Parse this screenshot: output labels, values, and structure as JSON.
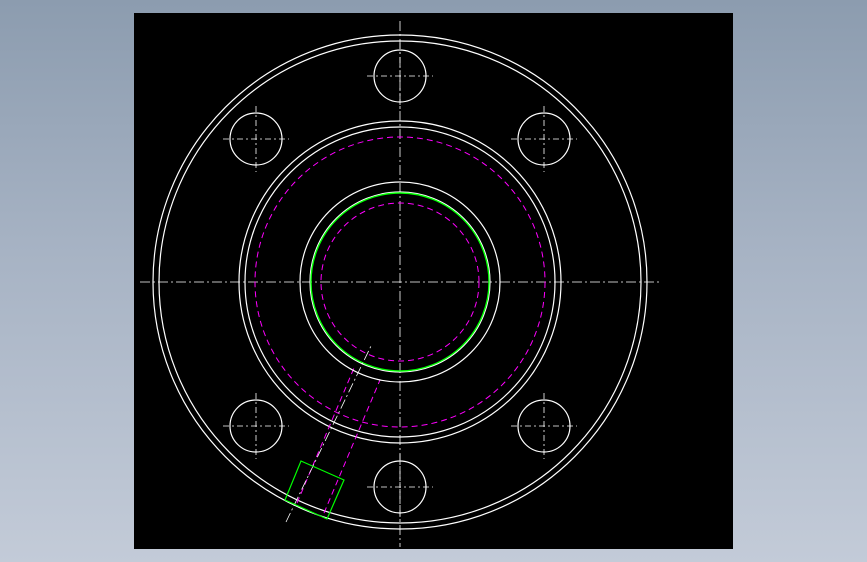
{
  "colors": {
    "background_gradient": [
      "#8c9caf",
      "#c3cbd8"
    ],
    "viewport": "#000000",
    "outline": "#ffffff",
    "hidden_line": "#ff00ff",
    "highlight": "#00ff00",
    "centerline": "#ffffff"
  },
  "drawing": {
    "part": "flange",
    "view": "front",
    "bolt_hole_count": 6,
    "features": [
      "outer-flange-rim",
      "raised-face",
      "bore",
      "bolt-holes",
      "tapped-port"
    ]
  }
}
